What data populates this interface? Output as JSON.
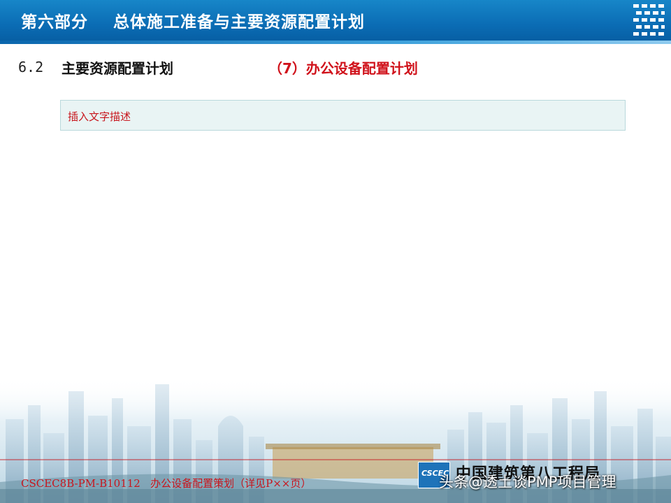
{
  "header": {
    "title": "第六部分    总体施工准备与主要资源配置计划",
    "logo_icon": "company-stripe-logo-icon"
  },
  "section": {
    "number": "6.2",
    "title": "主要资源配置计划",
    "subtitle": "（7）办公设备配置计划"
  },
  "text_box": {
    "placeholder": "插入文字描述"
  },
  "footer": {
    "doc_code": "CSCEC8B-PM-B10112   办公设备配置策划（详见P××页）",
    "logo_text": "CSCEC",
    "company": "中国建筑第八工程局"
  },
  "watermark": {
    "text": "头条@透土谈PMP项目管理"
  },
  "colors": {
    "header_blue": "#0b6db5",
    "accent_red": "#d0121b",
    "box_fill": "#e9f4f4"
  }
}
